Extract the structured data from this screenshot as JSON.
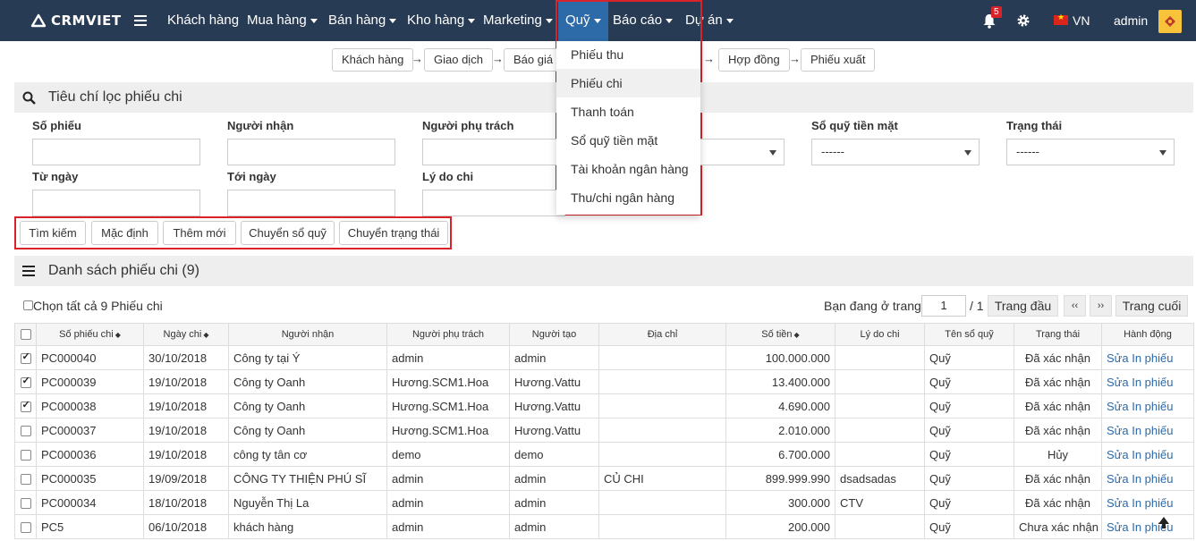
{
  "brand": "CRMVIET",
  "nav": {
    "items": [
      "Khách hàng",
      "Mua hàng",
      "Bán hàng",
      "Kho hàng",
      "Marketing",
      "Quỹ",
      "Báo cáo",
      "Dự án"
    ],
    "notif_count": "5",
    "lang": "VN",
    "user": "admin"
  },
  "flow": [
    "Khách hàng",
    "Giao dịch",
    "Báo giá",
    "Hợp đồng",
    "Phiếu xuất"
  ],
  "filter": {
    "title": "Tiêu chí lọc phiếu chi",
    "labels": [
      "Số phiếu",
      "Người nhận",
      "Người phụ trách",
      "Sổ quỹ tiền mặt",
      "Trạng thái",
      "Từ ngày",
      "Tới ngày",
      "Lý do chi"
    ],
    "select_default": "------",
    "buttons": [
      "Tìm kiếm",
      "Mặc định",
      "Thêm mới",
      "Chuyển sổ quỹ",
      "Chuyển trạng thái"
    ]
  },
  "list": {
    "title": "Danh sách phiếu chi (9)",
    "select_all": "Chọn tất cả 9 Phiếu chi",
    "page_text": "Bạn đang ở trang",
    "page_value": "1",
    "page_total": "/ 1",
    "first": "Trang đầu",
    "prev": "‹‹",
    "next": "››",
    "last": "Trang cuối"
  },
  "table": {
    "headers": [
      "Số phiếu chi",
      "Ngày chi",
      "Người nhận",
      "Người phụ trách",
      "Người tạo",
      "Địa chỉ",
      "Số tiền",
      "Lý do chi",
      "Tên sổ quỹ",
      "Trạng thái",
      "Hành động"
    ],
    "action_label": "Sửa In phiếu",
    "rows": [
      {
        "checked": true,
        "cells": [
          "PC000040",
          "30/10/2018",
          "Công ty tại Ý",
          "admin",
          "admin",
          "",
          "100.000.000",
          "",
          "Quỹ",
          "Đã xác nhận"
        ]
      },
      {
        "checked": true,
        "cells": [
          "PC000039",
          "19/10/2018",
          "Công ty Oanh",
          "Hương.SCM1.Hoa",
          "Hương.Vattu",
          "",
          "13.400.000",
          "",
          "Quỹ",
          "Đã xác nhận"
        ]
      },
      {
        "checked": true,
        "cells": [
          "PC000038",
          "19/10/2018",
          "Công ty Oanh",
          "Hương.SCM1.Hoa",
          "Hương.Vattu",
          "",
          "4.690.000",
          "",
          "Quỹ",
          "Đã xác nhận"
        ]
      },
      {
        "checked": false,
        "cells": [
          "PC000037",
          "19/10/2018",
          "Công ty Oanh",
          "Hương.SCM1.Hoa",
          "Hương.Vattu",
          "",
          "2.010.000",
          "",
          "Quỹ",
          "Đã xác nhận"
        ]
      },
      {
        "checked": false,
        "cells": [
          "PC000036",
          "19/10/2018",
          "công ty tân cơ",
          "demo",
          "demo",
          "",
          "6.700.000",
          "",
          "Quỹ",
          "Hủy"
        ]
      },
      {
        "checked": false,
        "cells": [
          "PC000035",
          "19/09/2018",
          "CÔNG TY THIỆN PHÚ SĨ",
          "admin",
          "admin",
          "CỦ CHI",
          "899.999.990",
          "dsadsadas",
          "Quỹ",
          "Đã xác nhận"
        ]
      },
      {
        "checked": false,
        "cells": [
          "PC000034",
          "18/10/2018",
          "Nguyễn Thị La",
          "admin",
          "admin",
          "",
          "300.000",
          "CTV",
          "Quỹ",
          "Đã xác nhận"
        ]
      },
      {
        "checked": false,
        "cells": [
          "PC5",
          "06/10/2018",
          "khách hàng",
          "admin",
          "admin",
          "",
          "200.000",
          "",
          "Quỹ",
          "Chưa xác nhận"
        ]
      }
    ]
  },
  "dropdown": {
    "items": [
      "Phiếu thu",
      "Phiếu chi",
      "Thanh toán",
      "Sổ quỹ tiền mặt",
      "Tài khoản ngân hàng",
      "Thu/chi ngân hàng"
    ],
    "active_index": 1
  },
  "colors": {
    "topbar": "#283b54",
    "highlight": "#d9232a",
    "active_nav": "#2d6aa8",
    "link": "#2d6aa8"
  }
}
